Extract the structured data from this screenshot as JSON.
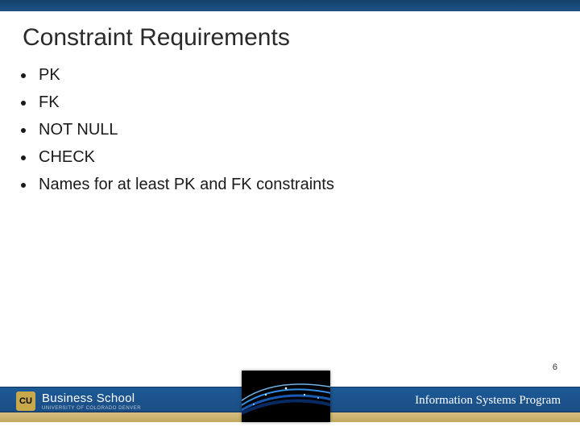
{
  "title": "Constraint Requirements",
  "bullets": [
    "PK",
    "FK",
    "NOT NULL",
    "CHECK",
    "Names for at least PK and FK constraints"
  ],
  "page_number": "6",
  "footer": {
    "program_text": "Information Systems Program",
    "logo_main": "Business School",
    "logo_sub": "UNIVERSITY OF COLORADO DENVER",
    "logo_badge": "CU"
  }
}
